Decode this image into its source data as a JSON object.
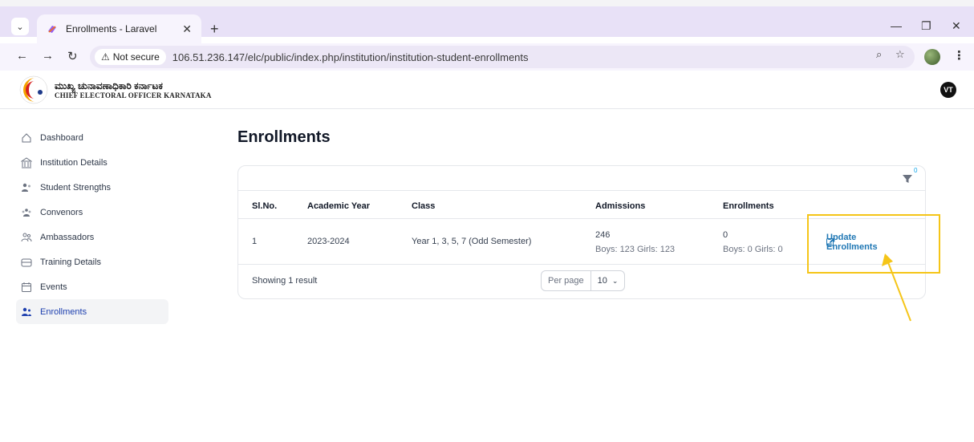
{
  "browser": {
    "tab_title": "Enrollments - Laravel",
    "new_tab": "+",
    "security_label": "Not secure",
    "url": "106.51.236.147/elc/public/index.php/institution/institution-student-enrollments"
  },
  "header": {
    "brand_kannada": "ಮುಖ್ಯ ಚುನಾವಣಾಧಿಕಾರಿ ಕರ್ನಾಟಕ",
    "brand_english": "CHIEF ELECTORAL OFFICER KARNATAKA",
    "avatar_initials": "VT"
  },
  "sidebar": {
    "items": [
      {
        "label": "Dashboard",
        "icon": "home-icon"
      },
      {
        "label": "Institution Details",
        "icon": "building-icon"
      },
      {
        "label": "Student Strengths",
        "icon": "users-icon"
      },
      {
        "label": "Convenors",
        "icon": "user-group-icon"
      },
      {
        "label": "Ambassadors",
        "icon": "people-outline-icon"
      },
      {
        "label": "Training Details",
        "icon": "training-icon"
      },
      {
        "label": "Events",
        "icon": "calendar-icon"
      },
      {
        "label": "Enrollments",
        "icon": "users-active-icon",
        "active": true
      }
    ]
  },
  "main": {
    "title": "Enrollments",
    "filter_count": "0",
    "columns": [
      "Sl.No.",
      "Academic Year",
      "Class",
      "Admissions",
      "Enrollments"
    ],
    "rows": [
      {
        "sl_no": "1",
        "academic_year": "2023-2024",
        "class": "Year 1, 3, 5, 7 (Odd Semester)",
        "admissions_total": "246",
        "admissions_detail": "Boys: 123 Girls: 123",
        "enrollments_total": "0",
        "enrollments_detail": "Boys: 0 Girls: 0",
        "action_label": "Update Enrollments"
      }
    ],
    "showing_text": "Showing 1 result",
    "per_page_label": "Per page",
    "per_page_value": "10"
  },
  "colors": {
    "accent": "#1f77b4",
    "highlight": "#f5c518",
    "tabbar": "#e8e1f7"
  }
}
